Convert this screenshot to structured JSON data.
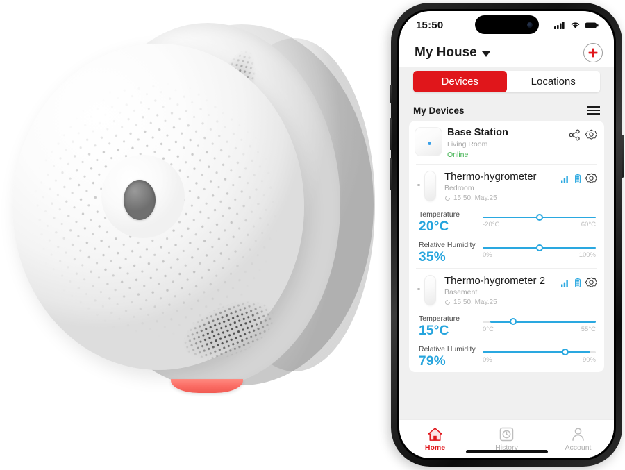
{
  "product": {
    "name": "smoke-detector",
    "description": "White circular smoke detector with perforated front face, mesh vent grilles, center button and red LED indicator",
    "led_color": "#f15b53"
  },
  "phone": {
    "status_bar": {
      "time": "15:50",
      "signal_icon": "cellular-signal-icon",
      "wifi_icon": "wifi-icon",
      "battery_icon": "battery-icon"
    },
    "navbar": {
      "title": "My House",
      "dropdown_icon": "chevron-down-icon",
      "add_icon": "plus-icon",
      "accent": "#e0161b"
    },
    "tabs": {
      "items": [
        {
          "label": "Devices",
          "active": true
        },
        {
          "label": "Locations",
          "active": false
        }
      ]
    },
    "section": {
      "title": "My Devices",
      "menu_icon": "hamburger-menu-icon"
    },
    "devices": [
      {
        "name": "Base Station",
        "location": "Living Room",
        "status": "Online",
        "status_color": "#3fb24f",
        "icons": [
          "share-icon",
          "gear-icon"
        ]
      },
      {
        "name": "Thermo-hygrometer",
        "location": "Bedroom",
        "timestamp": "15:50, May.25",
        "icons": [
          "signal-bars-icon",
          "battery-icon",
          "gear-icon"
        ],
        "metrics": [
          {
            "label": "Temperature",
            "value": "20°C",
            "min_label": "-20°C",
            "max_label": "60°C",
            "percent": 50
          },
          {
            "label": "Relative Humidity",
            "value": "35%",
            "min_label": "0%",
            "max_label": "100%",
            "percent": 50
          }
        ]
      },
      {
        "name": "Thermo-hygrometer 2",
        "location": "Basement",
        "timestamp": "15:50, May.25",
        "icons": [
          "signal-bars-icon",
          "battery-icon",
          "gear-icon"
        ],
        "metrics": [
          {
            "label": "Temperature",
            "value": "15°C",
            "min_label": "0°C",
            "max_label": "55°C",
            "percent": 27
          },
          {
            "label": "Relative Humidity",
            "value": "79%",
            "min_label": "0%",
            "max_label": "90%",
            "percent": 73
          }
        ]
      }
    ],
    "tabbar": [
      {
        "label": "Home",
        "icon": "home-icon",
        "active": true
      },
      {
        "label": "History",
        "icon": "history-clock-icon",
        "active": false
      },
      {
        "label": "Account",
        "icon": "person-icon",
        "active": false
      }
    ]
  }
}
